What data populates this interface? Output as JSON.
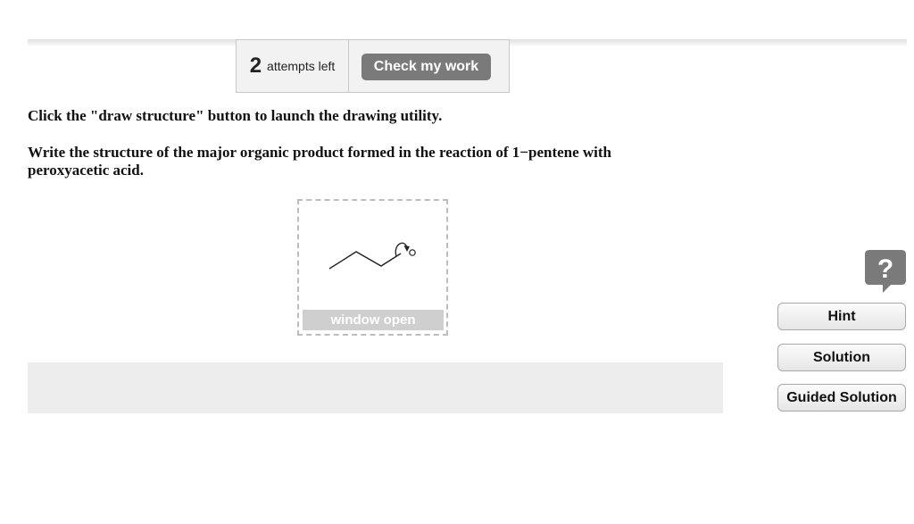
{
  "attempts": {
    "count": "2",
    "label": "attempts left"
  },
  "check_button_label": "Check my work",
  "instruction": "Click the \"draw structure\" button to launch the drawing utility.",
  "question": "Write the structure of the major organic product formed in the reaction of 1−pentene with peroxyacetic acid.",
  "drawing": {
    "atom_label": "O",
    "status": "window open"
  },
  "help_icon_glyph": "?",
  "side_buttons": {
    "hint": "Hint",
    "solution": "Solution",
    "guided_solution": "Guided Solution"
  },
  "colors": {
    "check_button": "#7a7a7a",
    "help_icon": "#7a7a7a",
    "feedback_area": "#ededed"
  }
}
